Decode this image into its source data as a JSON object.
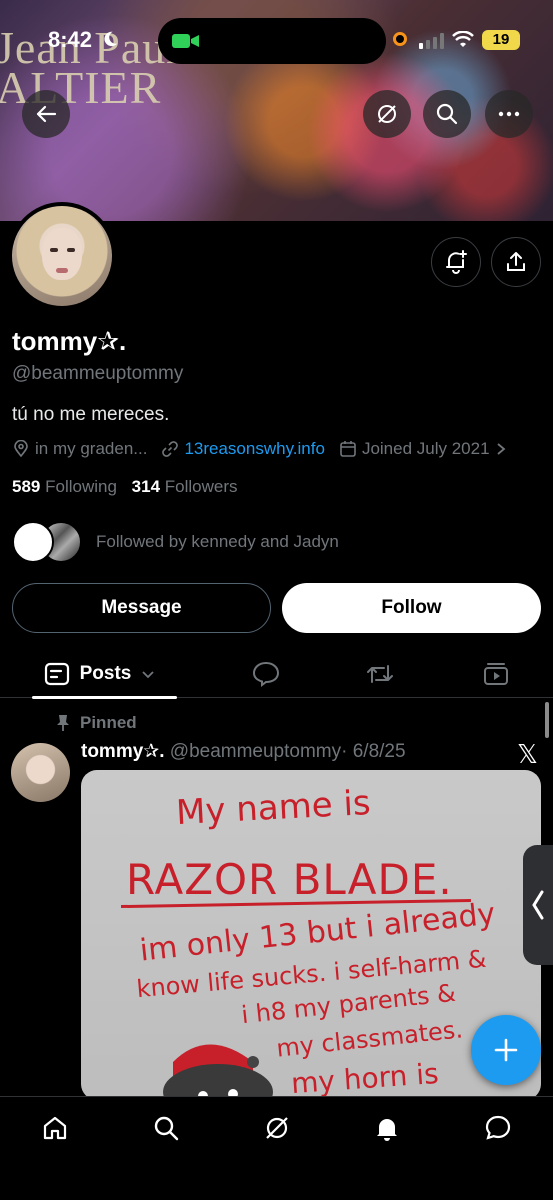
{
  "status_bar": {
    "time": "8:42",
    "battery": "19"
  },
  "banner": {
    "text_line1": "Jean Paul",
    "text_line2": "ALTIER"
  },
  "profile": {
    "display_name": "tommy✰.",
    "handle": "@beammeuptommy",
    "bio": "tú no me mereces.",
    "location": "in my graden...",
    "website": "13reasonswhy.info",
    "joined": "Joined July 2021",
    "following_count": "589",
    "following_label": "Following",
    "followers_count": "314",
    "followers_label": "Followers",
    "followed_by": "Followed by kennedy and Jadyn"
  },
  "actions": {
    "message_label": "Message",
    "follow_label": "Follow"
  },
  "tabs": {
    "posts_label": "Posts"
  },
  "post": {
    "pinned_label": "Pinned",
    "author_name": "tommy✰.",
    "author_handle": "@beammeuptommy",
    "date": "· 6/8/25",
    "image_text": {
      "line1": "My name is",
      "line2": "RAZOR BLADE.",
      "line3": "im only 13 but i already",
      "line4": "know life sucks. i self-harm &",
      "line5": "i h8 my parents &",
      "line6": "my classmates.",
      "line7": "my horn is"
    }
  },
  "colors": {
    "accent": "#1d9bf0",
    "background": "#000000",
    "muted_text": "#71767b"
  }
}
